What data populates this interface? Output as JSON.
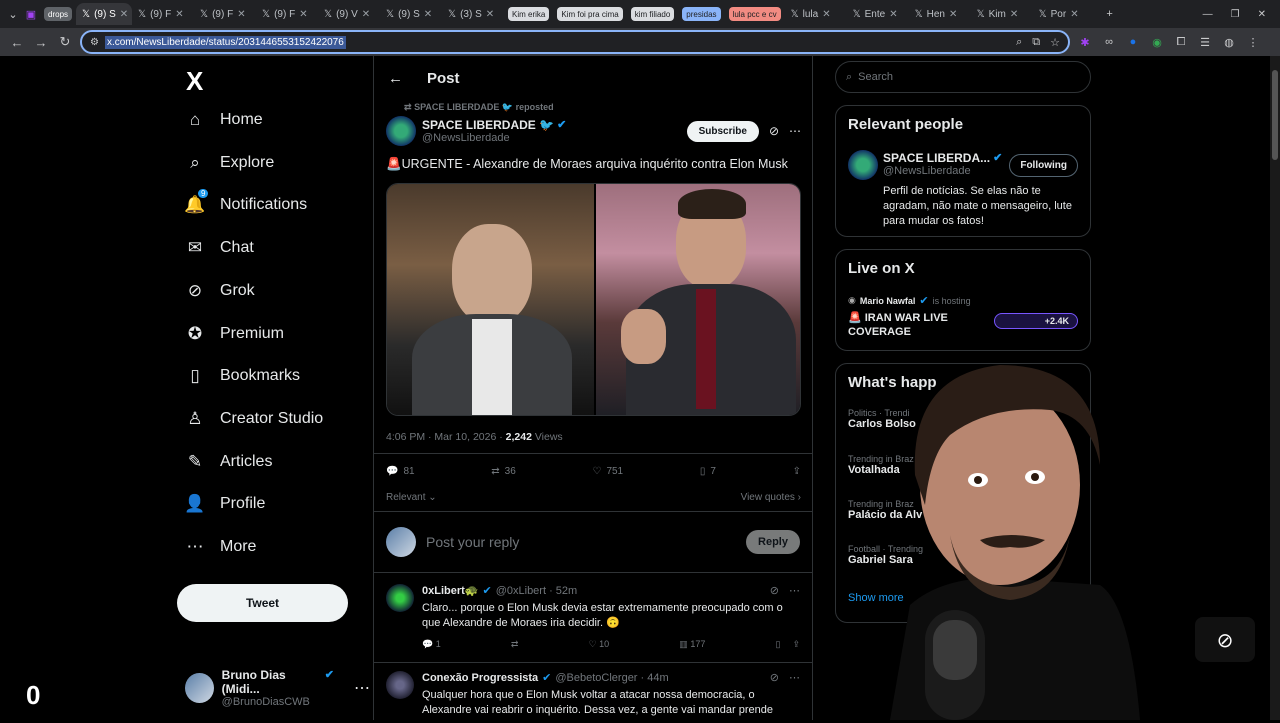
{
  "browser": {
    "tabs": [
      {
        "label": "drops",
        "type": "group",
        "color": "#5f6368"
      },
      {
        "label": "(9) S",
        "active": true
      },
      {
        "label": "(9) F"
      },
      {
        "label": "(9) F"
      },
      {
        "label": "(9) F"
      },
      {
        "label": "(9) V"
      },
      {
        "label": "(9) S"
      },
      {
        "label": "(3) S"
      },
      {
        "label": "Kim erika",
        "type": "group",
        "color": "#dadce0"
      },
      {
        "label": "Kim foi pra cima",
        "type": "group",
        "color": "#dadce0"
      },
      {
        "label": "kim filiado",
        "type": "group",
        "color": "#dadce0"
      },
      {
        "label": "presidas",
        "type": "group",
        "color": "#8ab4f8"
      },
      {
        "label": "lula pcc e cv",
        "type": "group",
        "color": "#f28b82"
      },
      {
        "label": "lula"
      },
      {
        "label": "Ente"
      },
      {
        "label": "Hen"
      },
      {
        "label": "Kim"
      },
      {
        "label": "Por"
      }
    ],
    "url": "x.com/NewsLiberdade/status/2031446553152422076"
  },
  "sidebar": {
    "logo": "X",
    "items": [
      {
        "label": "Home",
        "icon": "home-icon",
        "glyph": "⌂"
      },
      {
        "label": "Explore",
        "icon": "search-icon",
        "glyph": "⌕"
      },
      {
        "label": "Notifications",
        "icon": "bell-icon",
        "glyph": "🔔",
        "badge": "9"
      },
      {
        "label": "Chat",
        "icon": "mail-icon",
        "glyph": "✉"
      },
      {
        "label": "Grok",
        "icon": "grok-icon",
        "glyph": "⊘"
      },
      {
        "label": "Premium",
        "icon": "premium-icon",
        "glyph": "✪"
      },
      {
        "label": "Bookmarks",
        "icon": "bookmark-icon",
        "glyph": "▯"
      },
      {
        "label": "Creator Studio",
        "icon": "flask-icon",
        "glyph": "♙"
      },
      {
        "label": "Articles",
        "icon": "article-icon",
        "glyph": "✎"
      },
      {
        "label": "Profile",
        "icon": "person-icon",
        "glyph": "👤"
      },
      {
        "label": "More",
        "icon": "more-icon",
        "glyph": "⋯"
      }
    ],
    "tweet_button": "Tweet",
    "account": {
      "name": "Bruno Dias (Midi...",
      "handle": "@BrunoDiasCWB"
    }
  },
  "main": {
    "header_title": "Post",
    "repost_label": "SPACE LIBERDADE 🐦 reposted",
    "author": {
      "name": "SPACE LIBERDADE 🐦",
      "handle": "@NewsLiberdade"
    },
    "subscribe_label": "Subscribe",
    "text": "🚨URGENTE - Alexandre de Moraes arquiva inquérito contra Elon Musk",
    "timestamp": "4:06 PM · Mar 10, 2026 ·",
    "views_count": "2,242",
    "views_label": "Views",
    "stats": {
      "replies": "81",
      "reposts": "36",
      "likes": "751",
      "bookmarks": "7"
    },
    "relevant_label": "Relevant",
    "view_quotes_label": "View quotes",
    "reply_placeholder": "Post your reply",
    "reply_button": "Reply",
    "comments": [
      {
        "name": "0xLibert🐢",
        "handle": "@0xLibert · 52m",
        "text": "Claro... porque o Elon Musk devia estar extremamente preocupado com o que Alexandre de Moraes iria decidir. 🙃",
        "replies": "1",
        "likes": "10",
        "views": "177"
      },
      {
        "name": "Conexão Progressista",
        "handle": "@BebetoClerger · 44m",
        "text": "Qualquer hora que o Elon Musk voltar a atacar nossa democracia, o Alexandre vai reabrir o inquérito. Dessa vez, a gente vai mandar prende"
      }
    ]
  },
  "right": {
    "search_placeholder": "Search",
    "relevant_people_title": "Relevant people",
    "person": {
      "name": "SPACE LIBERDA...",
      "handle": "@NewsLiberdade",
      "bio": "Perfil de notícias. Se elas não te agradam, não mate o mensageiro, lute para mudar os fatos!",
      "follow_label": "Following"
    },
    "live_title": "Live on X",
    "live": {
      "host": "Mario Nawfal",
      "hosting_label": "is hosting",
      "title": "🚨 IRAN WAR LIVE COVERAGE",
      "listeners": "+2.4K"
    },
    "happening_title": "What's happ",
    "trends": [
      {
        "meta": "Politics · Trendi",
        "name": "Carlos Bolso"
      },
      {
        "meta": "Trending in Braz",
        "name": "Votalhada"
      },
      {
        "meta": "Trending in Braz",
        "name": "Palácio da Alv"
      },
      {
        "meta": "Football · Trending",
        "name": "Gabriel Sara"
      }
    ],
    "show_more": "Show more"
  },
  "overlay": {
    "counter": "0"
  }
}
